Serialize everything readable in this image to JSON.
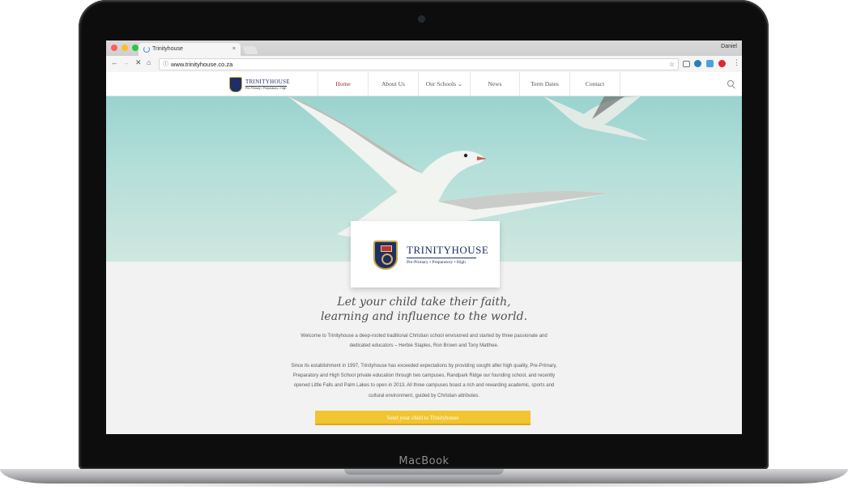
{
  "device": {
    "brand": "MacBook"
  },
  "browser": {
    "tab_title": "Trinityhouse",
    "tab_close": "×",
    "user": "Daniel",
    "url": "www.trinityhouse.co.za",
    "colors": {
      "close": "#ff5f57",
      "minimize": "#febc2e",
      "maximize": "#28c840"
    },
    "icons": [
      "back-icon",
      "forward-icon",
      "stop-icon",
      "home-icon",
      "info-icon",
      "star-icon",
      "cast-icon",
      "extension-icon",
      "shield-icon",
      "opera-icon",
      "menu-icon"
    ]
  },
  "site": {
    "logo": {
      "name": "TRINITYHOUSE",
      "sub": "Pre-Primary • Preparatory • High"
    },
    "nav": [
      {
        "label": "Home",
        "active": true
      },
      {
        "label": "About Us"
      },
      {
        "label": "Our Schools ⌄"
      },
      {
        "label": "News"
      },
      {
        "label": "Term Dates"
      },
      {
        "label": "Contact"
      }
    ],
    "accent": "#9b2a2a",
    "brand_blue": "#1f2e63",
    "cta_color": "#f2c431"
  },
  "content": {
    "tagline_1": "Let your child take their faith,",
    "tagline_2": "learning and influence to the world.",
    "para1_line1": "Welcome to Trinityhouse a deep-rooted traditional Christian school envisioned and started by three passionate and",
    "para1_line2": "dedicated educators – Herbie Staples, Ron Brown and Tony Matthee.",
    "para2_line1": "Since its establishment in 1997, Trinityhouse has exceeded expectations by providing sought after high quality, Pre-Primary,",
    "para2_line2": "Preparatory and High School private education through two campuses, Randpark Ridge our founding school, and recently",
    "para2_line3": "opened Little Falls and Palm Lakes to open in 2013. All three campuses boast a rich and rewarding academic, sports and",
    "para2_line4": "cultural environment, guided by Christian attributes.",
    "cta_label": "Send your child to Trinityhouse"
  }
}
